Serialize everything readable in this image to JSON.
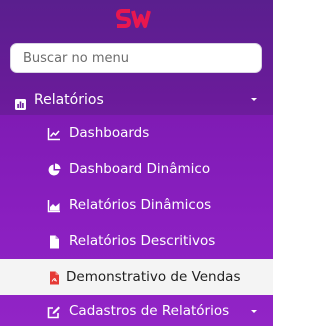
{
  "brand": {
    "logo_text": "SW",
    "logo_color": "#e8174f"
  },
  "search": {
    "placeholder": "Buscar no menu",
    "value": ""
  },
  "section": {
    "label": "Relatórios",
    "icon": "bar-chart-icon",
    "expanded": true
  },
  "items": [
    {
      "label": "Dashboards",
      "icon": "line-chart-icon",
      "active": false
    },
    {
      "label": "Dashboard Dinâmico",
      "icon": "pie-chart-icon",
      "active": false
    },
    {
      "label": "Relatórios Dinâmicos",
      "icon": "area-chart-icon",
      "active": false
    },
    {
      "label": "Relatórios Descritivos",
      "icon": "file-icon",
      "active": false
    },
    {
      "label": "Demonstrativo de Vendas",
      "icon": "pdf-file-icon",
      "active": true
    },
    {
      "label": "Cadastros de Relatórios",
      "icon": "edit-icon",
      "active": false,
      "has_submenu": true
    }
  ],
  "colors": {
    "sidebar_top": "#5a1f8e",
    "sidebar_bottom": "#9a24c8",
    "active_bg": "#f4f4f4",
    "pdf_icon": "#e53935"
  }
}
